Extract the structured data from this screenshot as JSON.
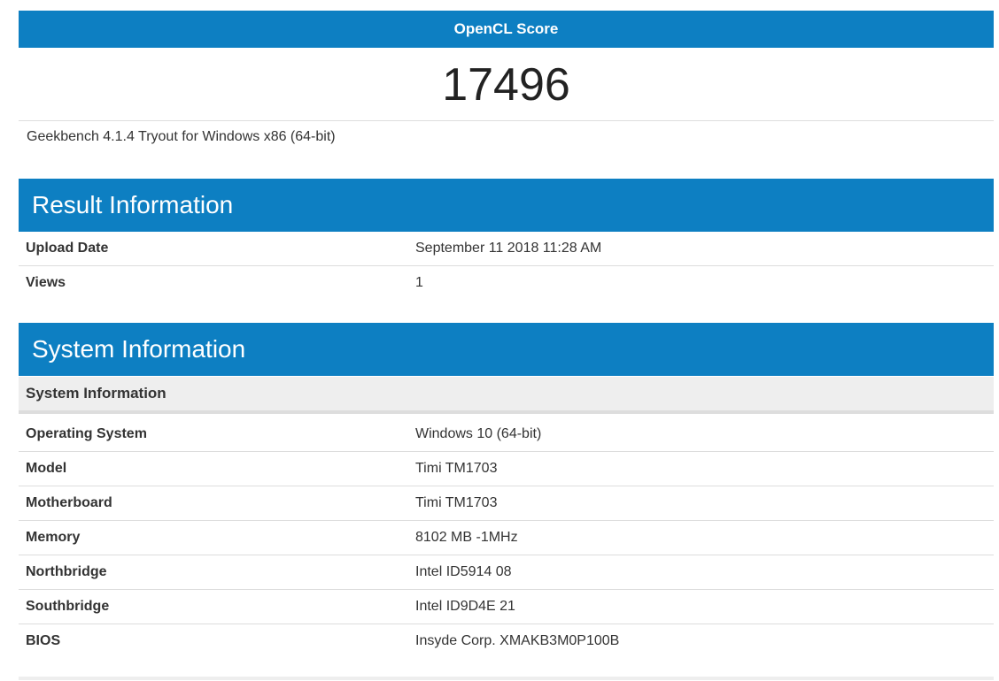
{
  "score": {
    "label": "OpenCL Score",
    "value": "17496",
    "platform": "Geekbench 4.1.4 Tryout for Windows x86 (64-bit)"
  },
  "result_info": {
    "title": "Result Information",
    "rows": [
      {
        "name": "Upload Date",
        "value": "September 11 2018 11:28 AM"
      },
      {
        "name": "Views",
        "value": "1"
      }
    ]
  },
  "system_info": {
    "title": "System Information",
    "subheader": "System Information",
    "rows": [
      {
        "name": "Operating System",
        "value": "Windows 10 (64-bit)"
      },
      {
        "name": "Model",
        "value": "Timi TM1703"
      },
      {
        "name": "Motherboard",
        "value": "Timi TM1703"
      },
      {
        "name": "Memory",
        "value": "8102 MB -1MHz"
      },
      {
        "name": "Northbridge",
        "value": "Intel ID5914 08"
      },
      {
        "name": "Southbridge",
        "value": "Intel ID9D4E 21"
      },
      {
        "name": "BIOS",
        "value": "Insyde Corp. XMAKB3M0P100B"
      }
    ]
  },
  "colors": {
    "accent": "#0d7fc2",
    "subheader_bg": "#eeeeee",
    "divider": "#dddddd"
  }
}
